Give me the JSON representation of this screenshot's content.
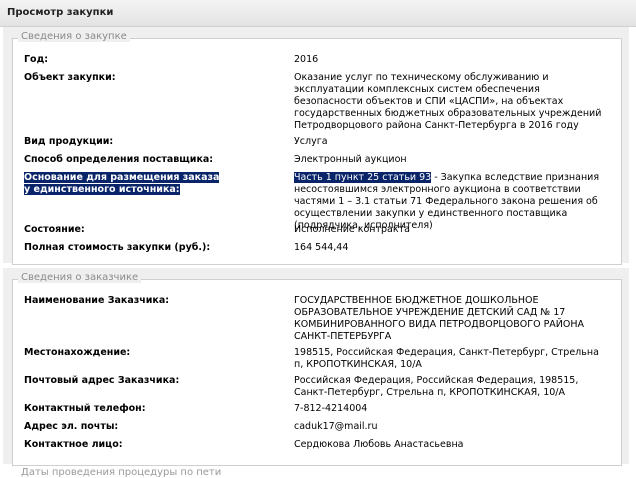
{
  "page": {
    "title": "Просмотр закупки"
  },
  "purchase": {
    "legend": "Сведения о закупке",
    "rows": [
      {
        "label": "Год:",
        "value": "2016"
      },
      {
        "label": "Объект закупки:",
        "value": "Оказание услуг по техническому обслуживанию и эксплуатации комплексных систем обеспечения безопасности объектов и СПИ «ЦАСПИ», на объектах государственных бюджетных образовательных учреждений Петродворцового района Санкт-Петербурга в 2016 году"
      },
      {
        "label": "Вид продукции:",
        "value": "Услуга"
      },
      {
        "label": "Способ определения поставщика:",
        "value": "Электронный аукцион"
      },
      {
        "label": "Основание для размещения заказа у единственного источника:",
        "value_highlight": "Часть 1 пункт 25 статьи 93",
        "value_rest": " - Закупка вследствие признания несостоявшимся электронного аукциона в соответствии частями 1 – 3.1 статьи 71 Федерального закона решения об осуществлении закупки у единственного поставщика (подрядчика, исполнителя)"
      },
      {
        "label": "Состояние:",
        "value": "Исполнение контракта"
      },
      {
        "label": "Полная стоимость закупки (руб.):",
        "value": "164 544,44"
      }
    ]
  },
  "customer": {
    "legend": "Сведения о заказчике",
    "rows": [
      {
        "label": "Наименование Заказчика:",
        "value": "ГОСУДАРСТВЕННОЕ БЮДЖЕТНОЕ ДОШКОЛЬНОЕ ОБРАЗОВАТЕЛЬНОЕ УЧРЕЖДЕНИЕ ДЕТСКИЙ САД № 17 КОМБИНИРОВАННОГО ВИДА ПЕТРОДВОРЦОВОГО РАЙОНА САНКТ-ПЕТЕРБУРГА"
      },
      {
        "label": "Местонахождение:",
        "value": "198515, Российская Федерация, Санкт-Петербург, Стрельна п, КРОПОТКИНСКАЯ, 10/А"
      },
      {
        "label": "Почтовый адрес Заказчика:",
        "value": "Российская Федерация, Российская Федерация, 198515, Санкт-Петербург, Стрельна п, КРОПОТКИНСКАЯ, 10/А"
      },
      {
        "label": "Контактный телефон:",
        "value": "7-812-4214004"
      },
      {
        "label": "Адрес эл. почты:",
        "value": "caduk17@mail.ru"
      },
      {
        "label": "Контактное лицо:",
        "value": "Сердюкова Любовь Анастасьевна"
      }
    ]
  },
  "next_section": {
    "legend": "Даты проведения процедуры по пети"
  }
}
